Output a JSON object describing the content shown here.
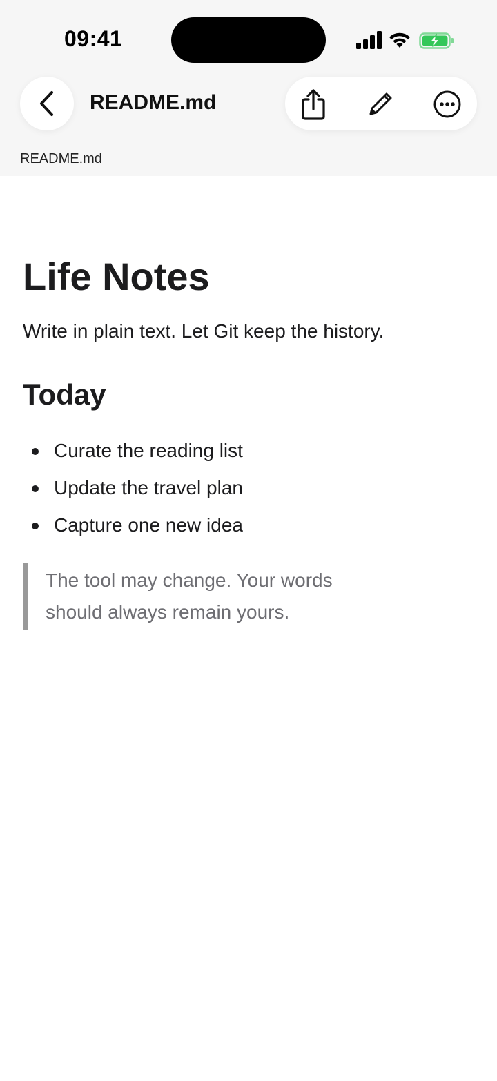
{
  "status_bar": {
    "time": "09:41",
    "icons": [
      "cellular-signal-icon",
      "wifi-icon",
      "battery-charging-icon"
    ],
    "battery_color": "#34c759"
  },
  "nav": {
    "back_icon": "chevron-left-icon",
    "title": "README.md",
    "actions": [
      "share-icon",
      "pencil-icon",
      "more-icon"
    ]
  },
  "breadcrumb": "README.md",
  "document": {
    "h1": "Life Notes",
    "intro": "Write in plain text. Let Git keep the history.",
    "h2": "Today",
    "list": [
      "Curate the reading list",
      "Update the travel plan",
      "Capture one new idea"
    ],
    "quote": "The tool may change. Your words should always remain yours."
  }
}
